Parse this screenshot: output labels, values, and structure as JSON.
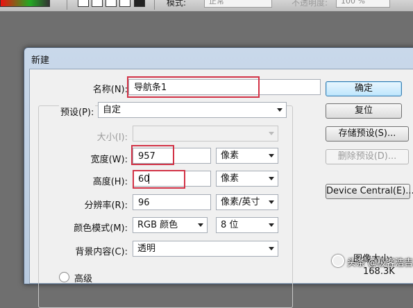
{
  "topbar": {
    "mode_label": "模式:",
    "mode_value": "正常",
    "opacity_label": "不透明度:",
    "opacity_value": "100 %"
  },
  "dialog": {
    "title": "新建",
    "name_label": "名称(N):",
    "name_value": "导航条1",
    "preset_label": "预设(P):",
    "preset_value": "自定",
    "size_label": "大小(I):",
    "size_value": "",
    "width_label": "宽度(W):",
    "width_value": "957",
    "width_unit": "像素",
    "height_label": "高度(H):",
    "height_value": "60",
    "height_unit": "像素",
    "resolution_label": "分辨率(R):",
    "resolution_value": "96",
    "resolution_unit": "像素/英寸",
    "color_mode_label": "颜色模式(M):",
    "color_mode_value": "RGB 颜色",
    "bit_depth_value": "8 位",
    "background_label": "背景内容(C):",
    "background_value": "透明",
    "advanced_label": "高级",
    "image_size_label": "图像大小:",
    "image_size_value": "168.3K"
  },
  "buttons": {
    "ok": "确定",
    "reset": "复位",
    "save_preset": "存储预设(S)...",
    "delete_preset": "删除预设(D)...",
    "device_central": "Device Central(E)..."
  },
  "watermark": "头条 @极客浩吉"
}
